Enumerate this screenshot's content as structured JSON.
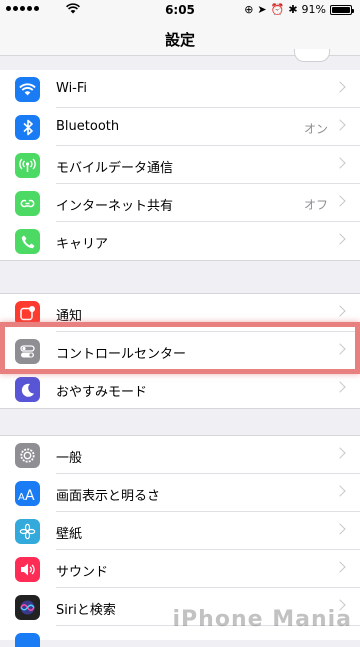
{
  "status": {
    "time": "6:05",
    "battery": "91%",
    "battery_level": 0.91
  },
  "nav": {
    "title": "設定"
  },
  "rows": {
    "wifi": {
      "label": "Wi-Fi",
      "value": "",
      "icon": "wifi-icon",
      "color": "#1a7cf5"
    },
    "bluetooth": {
      "label": "Bluetooth",
      "value": "オン",
      "icon": "bluetooth-icon",
      "color": "#1a7cf5"
    },
    "mobile": {
      "label": "モバイルデータ通信",
      "value": "",
      "icon": "antenna-icon",
      "color": "#4cd964"
    },
    "hotspot": {
      "label": "インターネット共有",
      "value": "オフ",
      "icon": "link-icon",
      "color": "#4cd964"
    },
    "carrier": {
      "label": "キャリア",
      "value": "",
      "icon": "phone-icon",
      "color": "#4cd964"
    },
    "notifications": {
      "label": "通知",
      "value": "",
      "icon": "notification-icon",
      "color": "#ff3b30"
    },
    "control_center": {
      "label": "コントロールセンター",
      "value": "",
      "icon": "switches-icon",
      "color": "#8e8e93"
    },
    "dnd": {
      "label": "おやすみモード",
      "value": "",
      "icon": "moon-icon",
      "color": "#5856d6"
    },
    "general": {
      "label": "一般",
      "value": "",
      "icon": "gear-icon",
      "color": "#8e8e93"
    },
    "display": {
      "label": "画面表示と明るさ",
      "value": "",
      "icon": "text-size-icon",
      "color": "#1a7cf5"
    },
    "wallpaper": {
      "label": "壁紙",
      "value": "",
      "icon": "flower-icon",
      "color": "#34aadc"
    },
    "sounds": {
      "label": "サウンド",
      "value": "",
      "icon": "speaker-icon",
      "color": "#ff2d55"
    },
    "siri": {
      "label": "Siriと検索",
      "value": "",
      "icon": "siri-icon",
      "color": "#222222"
    }
  },
  "watermark": "iPhone Mania"
}
